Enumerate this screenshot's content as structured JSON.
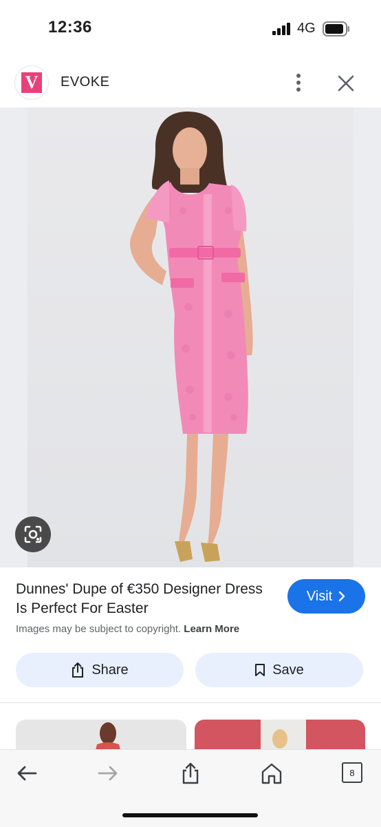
{
  "status_bar": {
    "time": "12:36",
    "network": "4G"
  },
  "header": {
    "site_name": "EVOKE",
    "logo_letter": "V"
  },
  "result": {
    "title": "Dunnes' Dupe of €350 Designer Dress Is Perfect For Easter",
    "visit_label": "Visit",
    "copyright_text": "Images may be subject to copyright.",
    "learn_more_label": "Learn More"
  },
  "actions": {
    "share_label": "Share",
    "save_label": "Save"
  },
  "bottom_nav": {
    "tab_count": "8"
  },
  "colors": {
    "accent": "#1a73e8",
    "dress": "#f28ab8",
    "logo": "#e8417a"
  }
}
